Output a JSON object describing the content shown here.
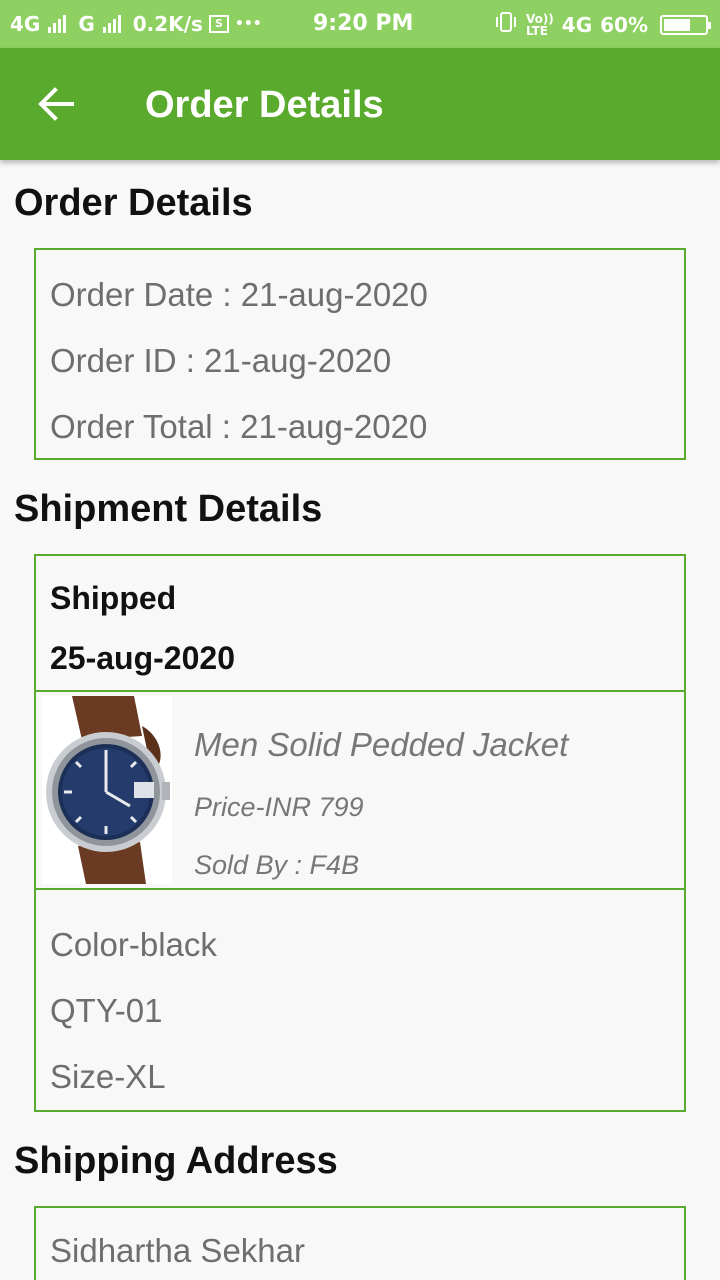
{
  "status_bar": {
    "network1": "4G",
    "network2": "G",
    "speed": "0.2K/s",
    "more": "•••",
    "time": "9:20 PM",
    "volte_top": "Vo))",
    "volte_bottom": "LTE",
    "network3": "4G",
    "battery": "60%"
  },
  "app_bar": {
    "title": "Order Details",
    "back_icon": "arrow-left-icon"
  },
  "order_details": {
    "heading": "Order Details",
    "order_date": "Order Date : 21-aug-2020",
    "order_id": "Order ID : 21-aug-2020",
    "order_total": "Order Total : 21-aug-2020"
  },
  "shipment_details": {
    "heading": "Shipment Details",
    "status": "Shipped",
    "date": "25-aug-2020",
    "product": {
      "name": "Men Solid Pedded Jacket",
      "price": "Price-INR 799",
      "sold_by": "Sold By : F4B",
      "image_icon": "wristwatch-product-image"
    },
    "color": "Color-black",
    "qty": "QTY-01",
    "size": "Size-XL"
  },
  "shipping_address": {
    "heading": "Shipping Address",
    "name": "Sidhartha Sekhar"
  },
  "colors": {
    "status_bar": "#8ed061",
    "app_bar": "#5aab2d",
    "card_border": "#5aab2d",
    "background": "#f8f8f8"
  }
}
